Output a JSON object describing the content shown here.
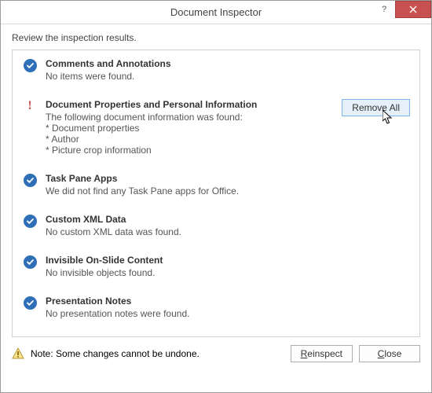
{
  "window": {
    "title": "Document Inspector",
    "help_tooltip": "Help",
    "close_tooltip": "Close"
  },
  "instruction": "Review the inspection results.",
  "sections": [
    {
      "status": "ok",
      "title": "Comments and Annotations",
      "desc": "No items were found.",
      "items": [],
      "action": null
    },
    {
      "status": "warn",
      "title": "Document Properties and Personal Information",
      "desc": "The following document information was found:",
      "items": [
        "* Document properties",
        "* Author",
        "* Picture crop information"
      ],
      "action": "Remove All"
    },
    {
      "status": "ok",
      "title": "Task Pane Apps",
      "desc": "We did not find any Task Pane apps for Office.",
      "items": [],
      "action": null
    },
    {
      "status": "ok",
      "title": "Custom XML Data",
      "desc": "No custom XML data was found.",
      "items": [],
      "action": null
    },
    {
      "status": "ok",
      "title": "Invisible On-Slide Content",
      "desc": "No invisible objects found.",
      "items": [],
      "action": null
    },
    {
      "status": "ok",
      "title": "Presentation Notes",
      "desc": "No presentation notes were found.",
      "items": [],
      "action": null
    }
  ],
  "footer": {
    "note": "Note: Some changes cannot be undone.",
    "reinspect_label": "Reinspect",
    "reinspect_accel": "R",
    "close_label": "Close",
    "close_accel": "C"
  }
}
